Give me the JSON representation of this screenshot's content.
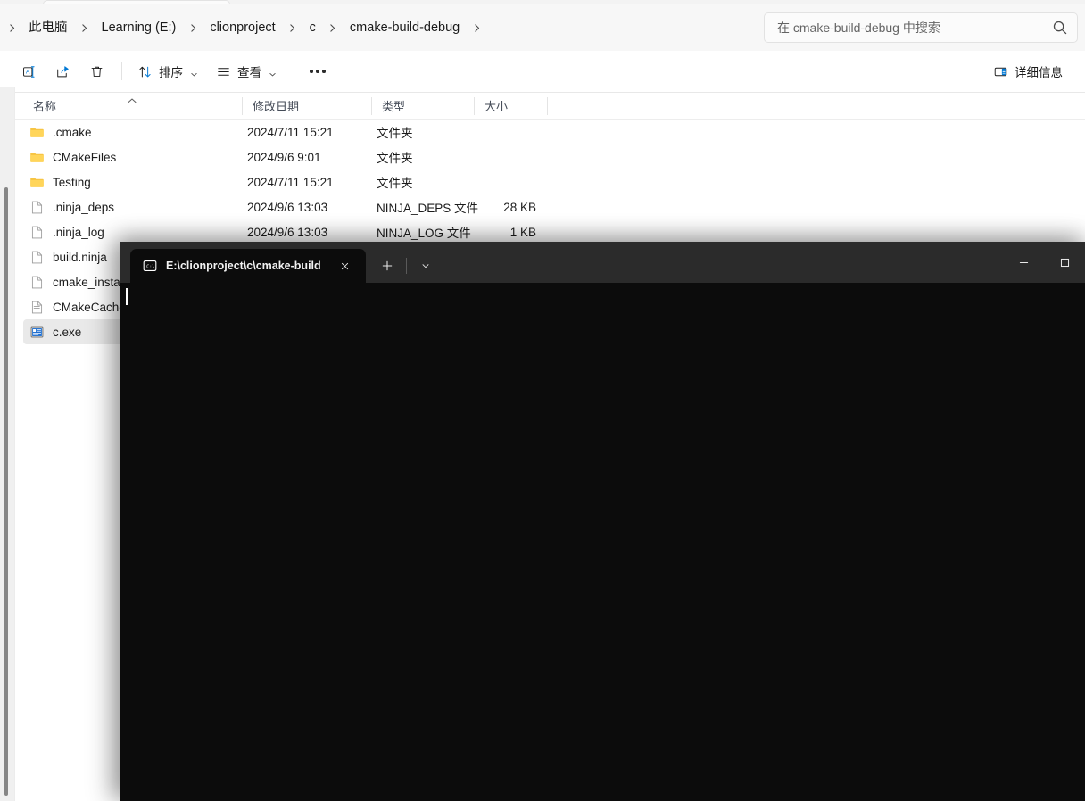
{
  "window": {
    "type": "file-explorer",
    "accent_color": "#0078d4",
    "bg_color": "#ffffff"
  },
  "address_bar": {
    "overflow_chevron": "›",
    "breadcrumbs": [
      {
        "label": "此电脑"
      },
      {
        "label": "Learning (E:)"
      },
      {
        "label": "clionproject"
      },
      {
        "label": "c"
      },
      {
        "label": "cmake-build-debug"
      }
    ],
    "separator": "›"
  },
  "search": {
    "placeholder": "在 cmake-build-debug 中搜索",
    "value": "",
    "icon": "search-icon"
  },
  "toolbar": {
    "rename_icon": "rename-icon",
    "share_icon": "share-icon",
    "delete_icon": "delete-trash-icon",
    "sort_label": "排序",
    "sort_icon": "sort-arrows-icon",
    "view_label": "查看",
    "view_icon": "view-lines-icon",
    "more_icon": "more-ellipsis-icon",
    "details_label": "详细信息",
    "details_icon": "details-pane-icon",
    "caret_icon": "chevron-down-icon"
  },
  "columns": [
    {
      "key": "name",
      "label": "名称",
      "sorted": "asc"
    },
    {
      "key": "date",
      "label": "修改日期"
    },
    {
      "key": "type",
      "label": "类型"
    },
    {
      "key": "size",
      "label": "大小"
    }
  ],
  "files": [
    {
      "icon": "folder-icon",
      "name": ".cmake",
      "date": "2024/7/11 15:21",
      "type": "文件夹",
      "size": "",
      "selected": false
    },
    {
      "icon": "folder-icon",
      "name": "CMakeFiles",
      "date": "2024/9/6 9:01",
      "type": "文件夹",
      "size": "",
      "selected": false
    },
    {
      "icon": "folder-icon",
      "name": "Testing",
      "date": "2024/7/11 15:21",
      "type": "文件夹",
      "size": "",
      "selected": false
    },
    {
      "icon": "file-icon",
      "name": ".ninja_deps",
      "date": "2024/9/6 13:03",
      "type": "NINJA_DEPS 文件",
      "size": "28 KB",
      "selected": false
    },
    {
      "icon": "file-icon",
      "name": ".ninja_log",
      "date": "2024/9/6 13:03",
      "type": "NINJA_LOG 文件",
      "size": "1 KB",
      "selected": false
    },
    {
      "icon": "file-icon",
      "name": "build.ninja",
      "date": "",
      "type": "",
      "size": "",
      "selected": false
    },
    {
      "icon": "file-icon",
      "name": "cmake_install.",
      "date": "",
      "type": "",
      "size": "",
      "selected": false
    },
    {
      "icon": "text-file-icon",
      "name": "CMakeCache.",
      "date": "",
      "type": "",
      "size": "",
      "selected": false
    },
    {
      "icon": "exe-icon",
      "name": "c.exe",
      "date": "",
      "type": "",
      "size": "",
      "selected": true
    }
  ],
  "terminal": {
    "tab": {
      "icon": "console-prompt-icon",
      "title": "E:\\clionproject\\c\\cmake-build",
      "close_icon": "close-x-icon"
    },
    "new_tab_icon": "plus-icon",
    "dropdown_icon": "chevron-down-icon",
    "window_controls": {
      "minimize_icon": "minimize-icon",
      "maximize_icon": "maximize-icon"
    },
    "content": "",
    "bg_color": "#0c0c0c",
    "titlebar_color": "#2b2b2b"
  }
}
